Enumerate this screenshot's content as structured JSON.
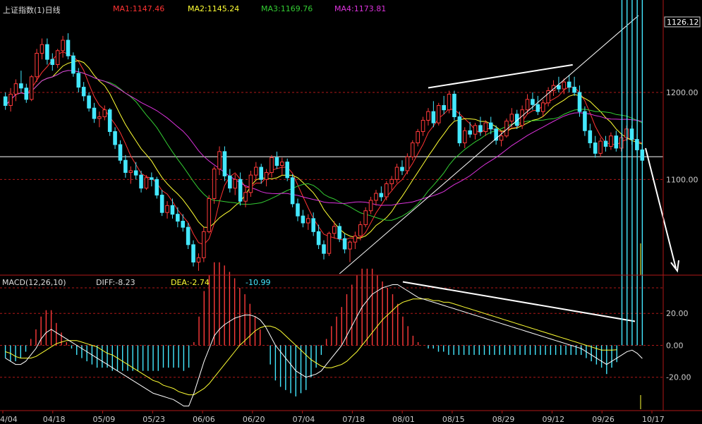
{
  "header": {
    "title": "上证指数(1)日线",
    "ma1": "MA1:1147.46",
    "ma2": "MA2:1145.24",
    "ma3": "MA3:1169.76",
    "ma4": "MA4:1173.81"
  },
  "macd_header": {
    "title": "MACD(12,26,10)",
    "diff": "DIFF:-8.23",
    "dea": "DEA:-2.74",
    "macd": "-10.99"
  },
  "colors": {
    "up": "#ff3a3a",
    "down": "#44e8ff",
    "ma1": "#ff3333",
    "ma2": "#ffff33",
    "ma3": "#33cc33",
    "ma4": "#dd33dd",
    "diff": "#ffffff",
    "dea": "#ffff33",
    "grid": "#b01818",
    "axis": "#b01818",
    "annotation": "#ffffff"
  },
  "chart_data": [
    {
      "type": "candlestick",
      "title": "上证指数(1)日线",
      "y_axis_labels": [
        "1126.12",
        "1200.00",
        "1100.00"
      ],
      "y_axis_ticks": [
        1200,
        1100
      ],
      "current_price_label": "1126.12",
      "current_price": 1126.12,
      "ylim": [
        990,
        1290
      ],
      "moving_averages": [
        {
          "name": "MA1",
          "value": 1147.46
        },
        {
          "name": "MA2",
          "value": 1145.24
        },
        {
          "name": "MA3",
          "value": 1169.76
        },
        {
          "name": "MA4",
          "value": 1173.81
        }
      ],
      "candles": [
        [
          1195,
          1200,
          1180,
          1185
        ],
        [
          1185,
          1205,
          1178,
          1198
        ],
        [
          1198,
          1215,
          1190,
          1210
        ],
        [
          1210,
          1225,
          1200,
          1205
        ],
        [
          1205,
          1210,
          1188,
          1192
        ],
        [
          1192,
          1220,
          1190,
          1218
        ],
        [
          1218,
          1250,
          1212,
          1245
        ],
        [
          1245,
          1262,
          1238,
          1255
        ],
        [
          1255,
          1262,
          1232,
          1238
        ],
        [
          1238,
          1245,
          1225,
          1232
        ],
        [
          1232,
          1250,
          1228,
          1248
        ],
        [
          1248,
          1265,
          1240,
          1260
        ],
        [
          1260,
          1268,
          1238,
          1242
        ],
        [
          1242,
          1246,
          1218,
          1222
        ],
        [
          1222,
          1228,
          1200,
          1206
        ],
        [
          1206,
          1212,
          1190,
          1196
        ],
        [
          1196,
          1200,
          1178,
          1182
        ],
        [
          1182,
          1188,
          1165,
          1170
        ],
        [
          1170,
          1178,
          1160,
          1172
        ],
        [
          1172,
          1185,
          1168,
          1180
        ],
        [
          1180,
          1182,
          1150,
          1155
        ],
        [
          1155,
          1160,
          1135,
          1140
        ],
        [
          1140,
          1145,
          1118,
          1122
        ],
        [
          1122,
          1128,
          1102,
          1108
        ],
        [
          1108,
          1115,
          1095,
          1110
        ],
        [
          1110,
          1120,
          1100,
          1105
        ],
        [
          1105,
          1110,
          1085,
          1090
        ],
        [
          1090,
          1105,
          1088,
          1102
        ],
        [
          1102,
          1108,
          1092,
          1100
        ],
        [
          1100,
          1103,
          1078,
          1082
        ],
        [
          1082,
          1088,
          1058,
          1062
        ],
        [
          1062,
          1075,
          1055,
          1070
        ],
        [
          1070,
          1078,
          1055,
          1060
        ],
        [
          1060,
          1068,
          1045,
          1052
        ],
        [
          1052,
          1060,
          1040,
          1045
        ],
        [
          1045,
          1050,
          1020,
          1025
        ],
        [
          1025,
          1030,
          1000,
          1005
        ],
        [
          1005,
          1015,
          995,
          1010
        ],
        [
          1010,
          1045,
          1005,
          1040
        ],
        [
          1040,
          1082,
          1038,
          1078
        ],
        [
          1078,
          1115,
          1072,
          1112
        ],
        [
          1112,
          1138,
          1105,
          1132
        ],
        [
          1132,
          1138,
          1098,
          1104
        ],
        [
          1104,
          1112,
          1085,
          1090
        ],
        [
          1090,
          1106,
          1082,
          1100
        ],
        [
          1100,
          1108,
          1070,
          1075
        ],
        [
          1075,
          1090,
          1068,
          1085
        ],
        [
          1085,
          1110,
          1080,
          1105
        ],
        [
          1105,
          1120,
          1098,
          1114
        ],
        [
          1114,
          1118,
          1095,
          1100
        ],
        [
          1100,
          1112,
          1092,
          1108
        ],
        [
          1108,
          1128,
          1102,
          1125
        ],
        [
          1125,
          1132,
          1112,
          1116
        ],
        [
          1116,
          1125,
          1105,
          1120
        ],
        [
          1120,
          1124,
          1098,
          1102
        ],
        [
          1102,
          1106,
          1068,
          1072
        ],
        [
          1072,
          1078,
          1052,
          1058
        ],
        [
          1058,
          1065,
          1045,
          1050
        ],
        [
          1050,
          1060,
          1042,
          1055
        ],
        [
          1055,
          1062,
          1035,
          1040
        ],
        [
          1040,
          1048,
          1020,
          1025
        ],
        [
          1025,
          1030,
          1008,
          1015
        ],
        [
          1015,
          1040,
          1012,
          1038
        ],
        [
          1038,
          1052,
          1032,
          1046
        ],
        [
          1046,
          1050,
          1028,
          1032
        ],
        [
          1032,
          1038,
          1015,
          1020
        ],
        [
          1020,
          1030,
          1005,
          1028
        ],
        [
          1028,
          1040,
          1020,
          1035
        ],
        [
          1035,
          1052,
          1030,
          1048
        ],
        [
          1048,
          1068,
          1045,
          1064
        ],
        [
          1064,
          1080,
          1060,
          1076
        ],
        [
          1076,
          1088,
          1070,
          1084
        ],
        [
          1084,
          1092,
          1075,
          1080
        ],
        [
          1080,
          1098,
          1076,
          1095
        ],
        [
          1095,
          1104,
          1088,
          1100
        ],
        [
          1100,
          1118,
          1096,
          1114
        ],
        [
          1114,
          1122,
          1105,
          1110
        ],
        [
          1110,
          1130,
          1106,
          1126
        ],
        [
          1126,
          1145,
          1122,
          1142
        ],
        [
          1142,
          1158,
          1138,
          1155
        ],
        [
          1155,
          1172,
          1150,
          1168
        ],
        [
          1168,
          1182,
          1162,
          1178
        ],
        [
          1178,
          1190,
          1160,
          1165
        ],
        [
          1165,
          1188,
          1162,
          1185
        ],
        [
          1185,
          1196,
          1175,
          1180
        ],
        [
          1180,
          1202,
          1176,
          1198
        ],
        [
          1198,
          1202,
          1168,
          1172
        ],
        [
          1172,
          1178,
          1138,
          1142
        ],
        [
          1142,
          1160,
          1136,
          1156
        ],
        [
          1156,
          1166,
          1148,
          1152
        ],
        [
          1152,
          1165,
          1146,
          1162
        ],
        [
          1162,
          1172,
          1150,
          1155
        ],
        [
          1155,
          1168,
          1150,
          1165
        ],
        [
          1165,
          1172,
          1152,
          1158
        ],
        [
          1158,
          1162,
          1140,
          1145
        ],
        [
          1145,
          1155,
          1138,
          1150
        ],
        [
          1150,
          1170,
          1148,
          1167
        ],
        [
          1167,
          1182,
          1160,
          1175
        ],
        [
          1175,
          1180,
          1158,
          1162
        ],
        [
          1162,
          1185,
          1158,
          1180
        ],
        [
          1180,
          1198,
          1175,
          1192
        ],
        [
          1192,
          1200,
          1180,
          1186
        ],
        [
          1186,
          1196,
          1174,
          1178
        ],
        [
          1178,
          1192,
          1172,
          1188
        ],
        [
          1188,
          1206,
          1184,
          1202
        ],
        [
          1202,
          1214,
          1196,
          1208
        ],
        [
          1208,
          1218,
          1200,
          1204
        ],
        [
          1204,
          1216,
          1198,
          1212
        ],
        [
          1212,
          1220,
          1200,
          1206
        ],
        [
          1206,
          1218,
          1196,
          1200
        ],
        [
          1200,
          1208,
          1172,
          1178
        ],
        [
          1178,
          1184,
          1150,
          1156
        ],
        [
          1156,
          1164,
          1136,
          1142
        ],
        [
          1142,
          1150,
          1125,
          1130
        ],
        [
          1130,
          1148,
          1126,
          1144
        ],
        [
          1144,
          1150,
          1132,
          1138
        ],
        [
          1138,
          1154,
          1134,
          1150
        ],
        [
          1150,
          1156,
          1132,
          1136
        ],
        [
          1136,
          1152,
          1132,
          1148
        ],
        [
          1148,
          1162,
          1144,
          1158
        ],
        [
          1158,
          1162,
          1140,
          1146
        ],
        [
          1146,
          1152,
          1130,
          1134
        ],
        [
          1134,
          1138,
          1118,
          1122
        ]
      ],
      "x_tick_labels": [
        "4/04",
        "04/18",
        "05/09",
        "05/23",
        "06/06",
        "06/20",
        "07/04",
        "07/18",
        "08/01",
        "08/15",
        "08/29",
        "09/12",
        "09/26",
        "10/17"
      ],
      "annotations": [
        "upper trendline at price highs (08/15 to 09/19)",
        "rising trendline from 07/18 low",
        "horizontal support line at current price",
        "downward projection arrow"
      ]
    },
    {
      "type": "macd",
      "title": "MACD(12,26,10)",
      "y_axis_labels": [
        "20.00",
        "0.00",
        "-20.00"
      ],
      "y_axis_ticks": [
        20,
        0,
        -20
      ],
      "ylim": [
        -40,
        36
      ],
      "latest": {
        "DIFF": -8.23,
        "DEA": -2.74,
        "MACD": -10.99
      },
      "diff": [
        -8,
        -10,
        -12,
        -12,
        -10,
        -6,
        -2,
        4,
        8,
        10,
        8,
        6,
        4,
        2,
        0,
        -2,
        -4,
        -6,
        -8,
        -10,
        -12,
        -14,
        -16,
        -18,
        -20,
        -22,
        -24,
        -26,
        -28,
        -30,
        -31,
        -32,
        -33,
        -34,
        -36,
        -38,
        -38,
        -30,
        -20,
        -10,
        -2,
        6,
        10,
        13,
        15,
        17,
        18,
        19,
        19,
        18,
        16,
        12,
        6,
        0,
        -4,
        -8,
        -12,
        -16,
        -18,
        -20,
        -19,
        -18,
        -16,
        -12,
        -8,
        -4,
        0,
        6,
        12,
        18,
        24,
        28,
        32,
        34,
        36,
        37,
        38,
        38,
        36,
        34,
        32,
        30,
        29,
        28,
        27,
        26,
        25,
        24,
        23,
        22,
        21,
        20,
        19,
        18,
        17,
        16,
        15,
        14,
        13,
        12,
        11,
        10,
        9,
        8,
        7,
        6,
        5,
        4,
        3,
        2,
        1,
        0,
        -1,
        -2,
        -4,
        -6,
        -8,
        -10,
        -12,
        -10,
        -8,
        -6,
        -4,
        -3,
        -5,
        -8.23
      ],
      "dea": [
        -4,
        -5,
        -7,
        -8,
        -8,
        -8,
        -7,
        -5,
        -3,
        -1,
        1,
        2,
        3,
        3,
        3,
        2,
        1,
        0,
        -1,
        -3,
        -5,
        -6,
        -8,
        -10,
        -12,
        -14,
        -16,
        -18,
        -20,
        -22,
        -23,
        -25,
        -26,
        -27,
        -29,
        -30,
        -31,
        -31,
        -29,
        -27,
        -24,
        -20,
        -16,
        -12,
        -8,
        -4,
        0,
        3,
        6,
        9,
        11,
        12,
        12,
        11,
        9,
        6,
        3,
        0,
        -3,
        -6,
        -9,
        -11,
        -13,
        -14,
        -14,
        -13,
        -12,
        -10,
        -7,
        -4,
        0,
        4,
        8,
        12,
        16,
        19,
        22,
        25,
        27,
        28,
        29,
        29,
        29,
        29,
        28,
        28,
        27,
        27,
        26,
        25,
        24,
        23,
        22,
        21,
        20,
        19,
        18,
        17,
        16,
        15,
        14,
        13,
        12,
        11,
        10,
        9,
        8,
        7,
        6,
        5,
        4,
        3,
        2,
        1,
        0,
        -1,
        -2,
        -3,
        -3,
        -3,
        -2.74
      ]
    }
  ]
}
